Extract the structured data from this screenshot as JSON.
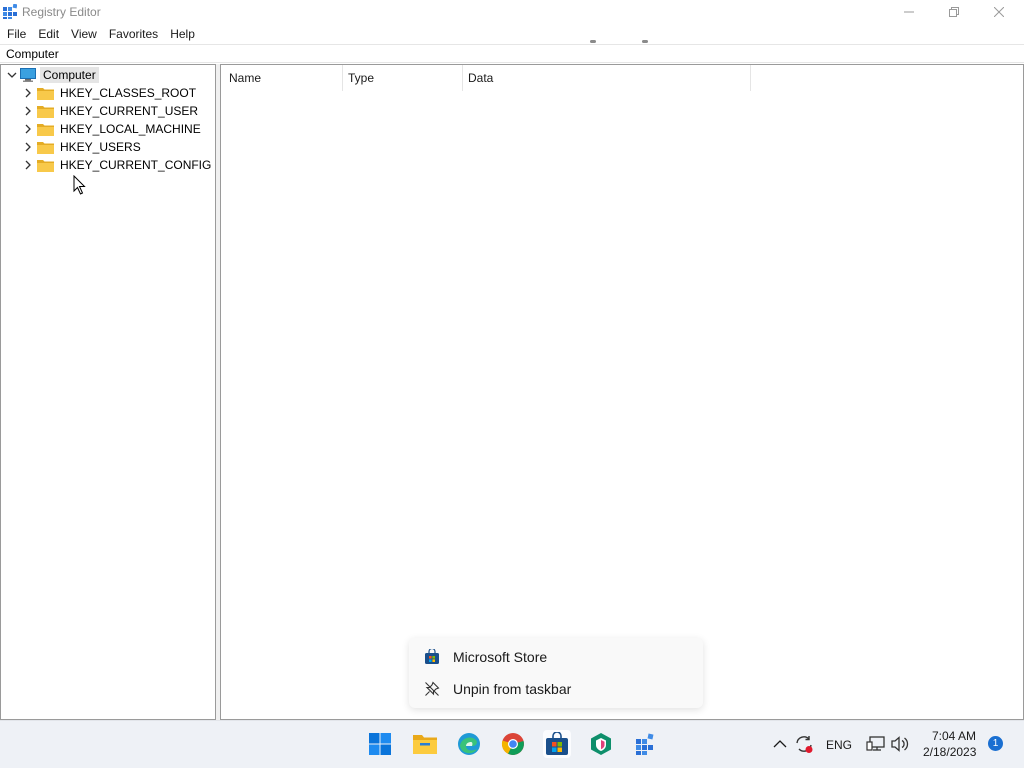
{
  "window": {
    "title": "Registry Editor"
  },
  "menu": [
    "File",
    "Edit",
    "View",
    "Favorites",
    "Help"
  ],
  "address": {
    "path": "Computer"
  },
  "tree": {
    "root": "Computer",
    "keys": [
      "HKEY_CLASSES_ROOT",
      "HKEY_CURRENT_USER",
      "HKEY_LOCAL_MACHINE",
      "HKEY_USERS",
      "HKEY_CURRENT_CONFIG"
    ]
  },
  "list": {
    "columns": [
      "Name",
      "Type",
      "Data"
    ]
  },
  "context_menu": {
    "items": [
      {
        "label": "Microsoft Store",
        "icon": "microsoft-store-icon"
      },
      {
        "label": "Unpin from taskbar",
        "icon": "unpin-icon"
      }
    ]
  },
  "taskbar": {
    "apps": [
      "start-icon",
      "file-explorer-icon",
      "edge-icon",
      "chrome-icon",
      "microsoft-store-icon",
      "security-app-icon",
      "registry-editor-icon"
    ],
    "tray": {
      "language": "ENG",
      "time": "7:04 AM",
      "date": "2/18/2023",
      "notification_count": "1"
    }
  },
  "colors": {
    "folder": "#f8c94a",
    "folder_dark": "#e4ac25",
    "accent": "#0067c0",
    "selection": "#e5e5e5"
  }
}
